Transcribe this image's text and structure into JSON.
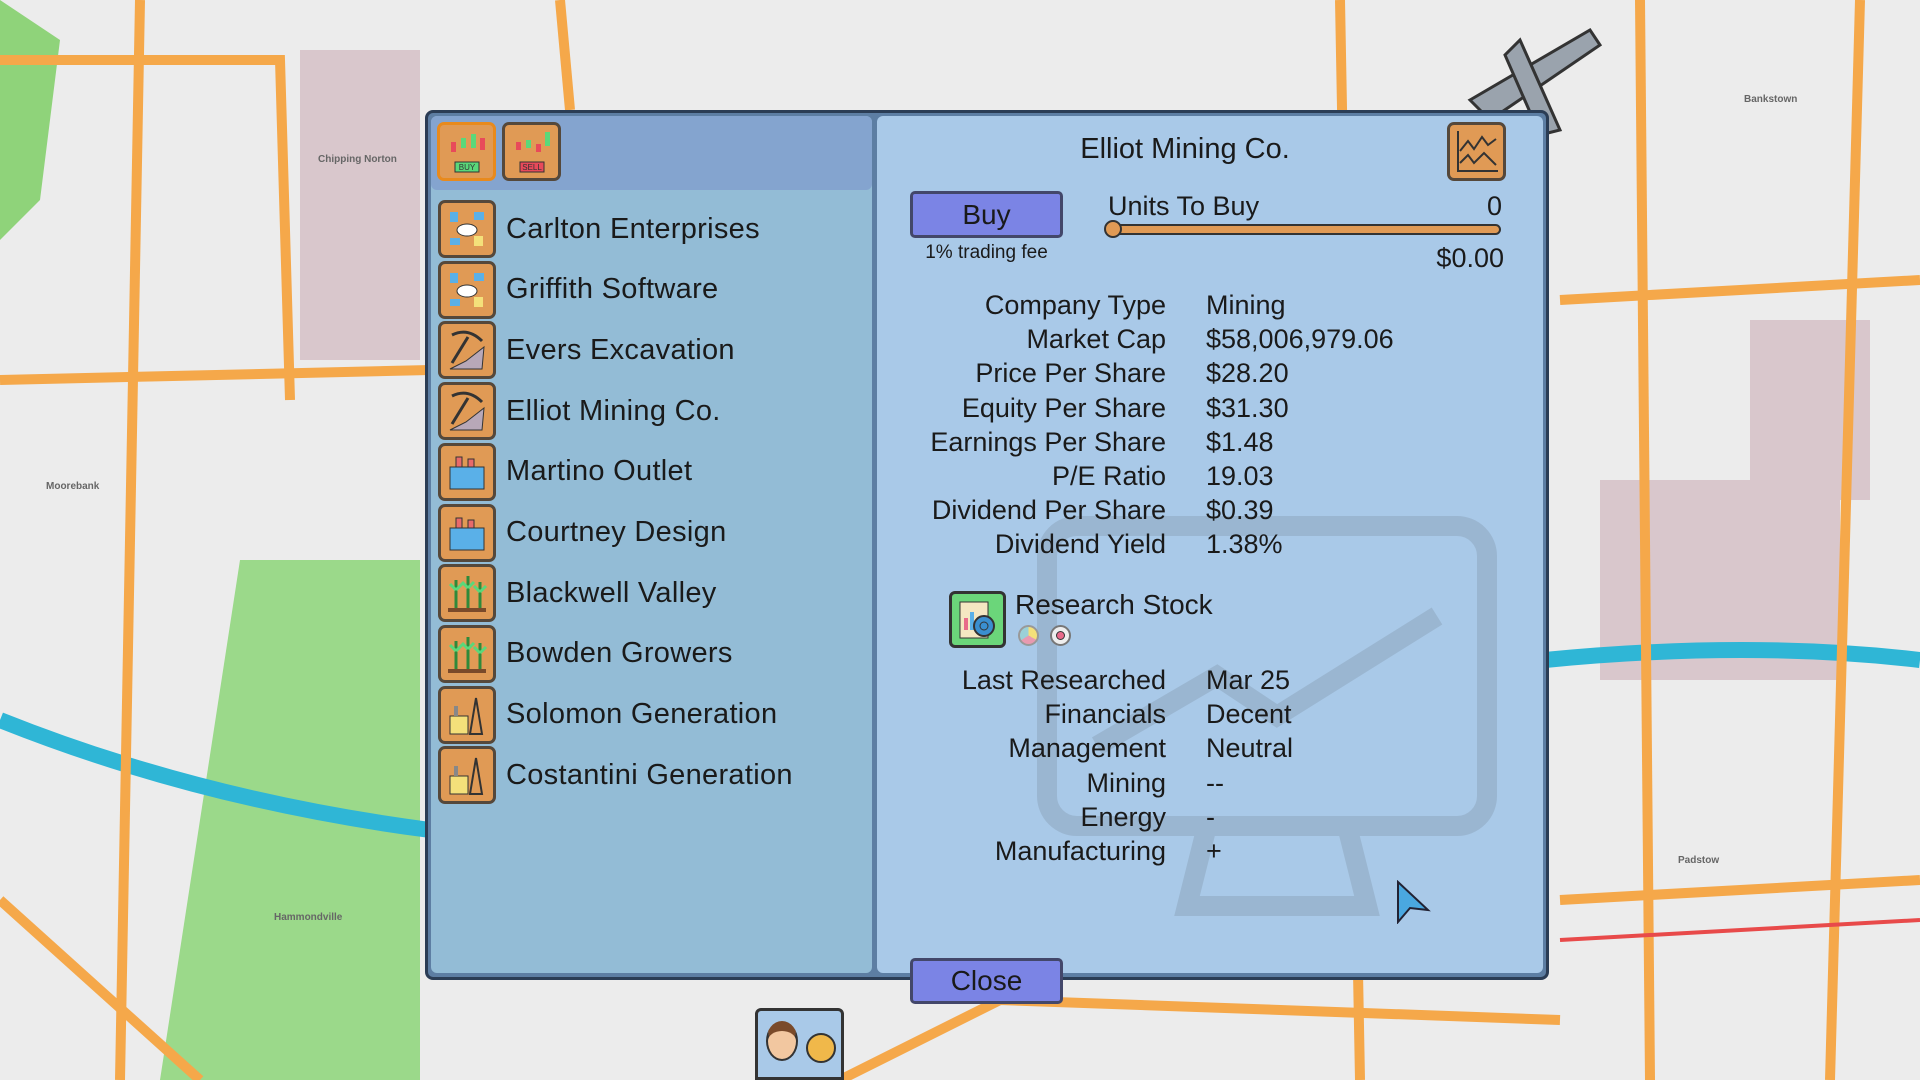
{
  "map_labels": [
    "Chipping Norton",
    "Moorebank",
    "Hammondville",
    "Bankstown",
    "Padstow"
  ],
  "toolbar": {
    "buy_mode_icon": "buy-chart-icon",
    "sell_mode_icon": "sell-chart-icon"
  },
  "companies": [
    {
      "name": "Carlton Enterprises",
      "icon": "network-icon"
    },
    {
      "name": "Griffith Software",
      "icon": "network-icon"
    },
    {
      "name": "Evers Excavation",
      "icon": "pickaxe-icon"
    },
    {
      "name": "Elliot Mining Co.",
      "icon": "pickaxe-icon"
    },
    {
      "name": "Martino Outlet",
      "icon": "factory-icon"
    },
    {
      "name": "Courtney Design",
      "icon": "factory-icon"
    },
    {
      "name": "Blackwell Valley",
      "icon": "crops-icon"
    },
    {
      "name": "Bowden Growers",
      "icon": "crops-icon"
    },
    {
      "name": "Solomon Generation",
      "icon": "power-plant-icon"
    },
    {
      "name": "Costantini Generation",
      "icon": "power-plant-icon"
    }
  ],
  "detail": {
    "title": "Elliot Mining Co.",
    "buy_label": "Buy",
    "fee_note": "1% trading fee",
    "units_label": "Units To Buy",
    "units_value": "0",
    "slider_fraction": 0,
    "total_cost": "$0.00",
    "stats": [
      {
        "k": "Company Type",
        "v": "Mining"
      },
      {
        "k": "Market Cap",
        "v": "$58,006,979.06"
      },
      {
        "k": "Price Per Share",
        "v": "$28.20"
      },
      {
        "k": "Equity Per Share",
        "v": "$31.30"
      },
      {
        "k": "Earnings Per Share",
        "v": "$1.48"
      },
      {
        "k": "P/E Ratio",
        "v": "19.03"
      },
      {
        "k": "Dividend Per Share",
        "v": "$0.39"
      },
      {
        "k": "Dividend Yield",
        "v": "1.38%"
      }
    ],
    "research_label": "Research Stock",
    "research": [
      {
        "k": "Last Researched",
        "v": "Mar 25"
      },
      {
        "k": "Financials",
        "v": "Decent"
      },
      {
        "k": "Management",
        "v": "Neutral"
      },
      {
        "k": "Mining",
        "v": "--"
      },
      {
        "k": "Energy",
        "v": "-"
      },
      {
        "k": "Manufacturing",
        "v": "+"
      }
    ],
    "close_label": "Close"
  },
  "colors": {
    "accent": "#7b84e5",
    "icon_bg": "#e09a55",
    "panel": "#a9c9e8",
    "list": "#93bcd6"
  }
}
